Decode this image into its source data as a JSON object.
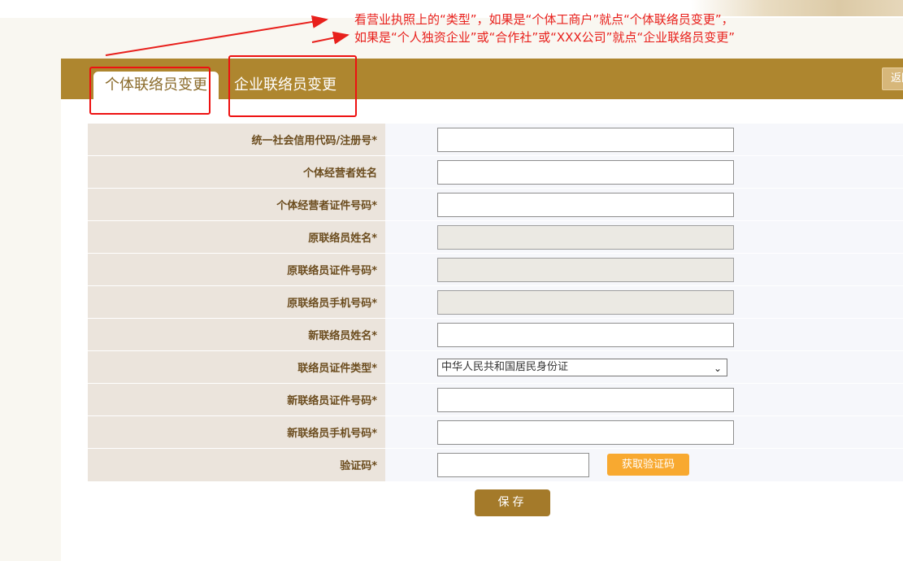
{
  "annotations": {
    "line1": "看营业执照上的“类型”，如果是“个体工商户”就点“个体联络员变更”，",
    "line2": "如果是“个人独资企业”或“合作社”或“XXX公司”就点“企业联络员变更”",
    "color": "#e8201c"
  },
  "tabs": [
    {
      "label": "个体联络员变更",
      "active": true
    },
    {
      "label": "企业联络员变更",
      "active": false
    }
  ],
  "header": {
    "back_label": "返回",
    "color": "#ae862f"
  },
  "form": {
    "rows": [
      {
        "label": "统一社会信用代码/注册号*",
        "value": ""
      },
      {
        "label": "个体经营者姓名",
        "value": ""
      },
      {
        "label": "个体经营者证件号码*",
        "value": ""
      },
      {
        "label": "原联络员姓名*",
        "value": ""
      },
      {
        "label": "原联络员证件号码*",
        "value": ""
      },
      {
        "label": "原联络员手机号码*",
        "value": ""
      },
      {
        "label": "新联络员姓名*",
        "value": ""
      },
      {
        "label": "联络员证件类型*",
        "selected": "中华人民共和国居民身份证"
      },
      {
        "label": "新联络员证件号码*",
        "value": ""
      },
      {
        "label": "新联络员手机号码*",
        "value": ""
      },
      {
        "label": "验证码*",
        "value": ""
      }
    ],
    "sms_button_label": "获取验证码",
    "save_label": "保存"
  },
  "icons": {
    "select_caret": "chevron-down-icon"
  },
  "colors": {
    "accent": "#ae862f",
    "label_bg": "#ebe4dc",
    "sms_button": "#f8a930",
    "save_button": "#a47a2a",
    "annotation_box": "#ee1111"
  }
}
